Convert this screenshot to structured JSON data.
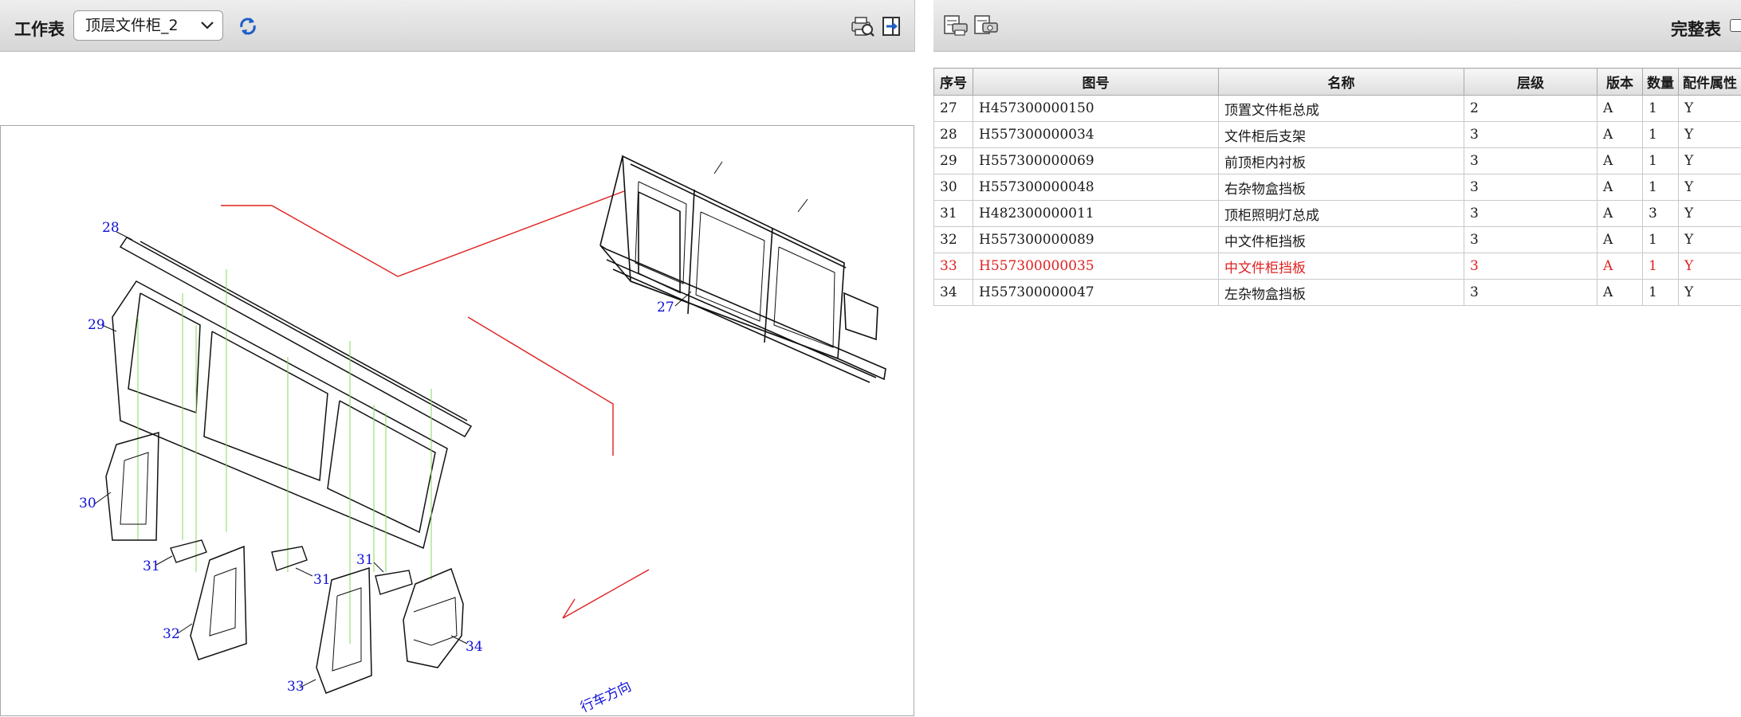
{
  "left_toolbar": {
    "label": "工作表",
    "sheet_select": {
      "value": "顶层文件柜_2"
    },
    "icons": [
      "refresh-icon",
      "print-preview-icon",
      "export-icon"
    ]
  },
  "right_toolbar": {
    "icons": [
      "print-table-icon",
      "export-table-icon"
    ],
    "full_table_label": "完整表",
    "full_table_checked": false
  },
  "diagram": {
    "callouts": [
      {
        "number": "28"
      },
      {
        "number": "29"
      },
      {
        "number": "30"
      },
      {
        "number": "31"
      },
      {
        "number": "31"
      },
      {
        "number": "31"
      },
      {
        "number": "32"
      },
      {
        "number": "33"
      },
      {
        "number": "34"
      },
      {
        "number": "27"
      }
    ],
    "direction_label": "行车方向",
    "colors": {
      "callout": "#1010d8",
      "leader": "#e02020",
      "guide": "#8ad85c"
    }
  },
  "table": {
    "columns": [
      "序号",
      "图号",
      "名称",
      "层级",
      "版本",
      "数量",
      "配件属性"
    ],
    "rows": [
      {
        "seq": "27",
        "part_no": "H457300000150",
        "name": "顶置文件柜总成",
        "level": "2",
        "version": "A",
        "qty": "1",
        "attr": "Y"
      },
      {
        "seq": "28",
        "part_no": "H557300000034",
        "name": "文件柜后支架",
        "level": "3",
        "version": "A",
        "qty": "1",
        "attr": "Y"
      },
      {
        "seq": "29",
        "part_no": "H557300000069",
        "name": "前顶柜内衬板",
        "level": "3",
        "version": "A",
        "qty": "1",
        "attr": "Y"
      },
      {
        "seq": "30",
        "part_no": "H557300000048",
        "name": "右杂物盒挡板",
        "level": "3",
        "version": "A",
        "qty": "1",
        "attr": "Y"
      },
      {
        "seq": "31",
        "part_no": "H482300000011",
        "name": "顶柜照明灯总成",
        "level": "3",
        "version": "A",
        "qty": "3",
        "attr": "Y"
      },
      {
        "seq": "32",
        "part_no": "H557300000089",
        "name": "中文件柜挡板",
        "level": "3",
        "version": "A",
        "qty": "1",
        "attr": "Y"
      },
      {
        "seq": "33",
        "part_no": "H557300000035",
        "name": "中文件柜挡板",
        "level": "3",
        "version": "A",
        "qty": "1",
        "attr": "Y"
      },
      {
        "seq": "34",
        "part_no": "H557300000047",
        "name": "左杂物盒挡板",
        "level": "3",
        "version": "A",
        "qty": "1",
        "attr": "Y"
      }
    ],
    "selected_seq": "33",
    "selected_color": "#e02020"
  }
}
